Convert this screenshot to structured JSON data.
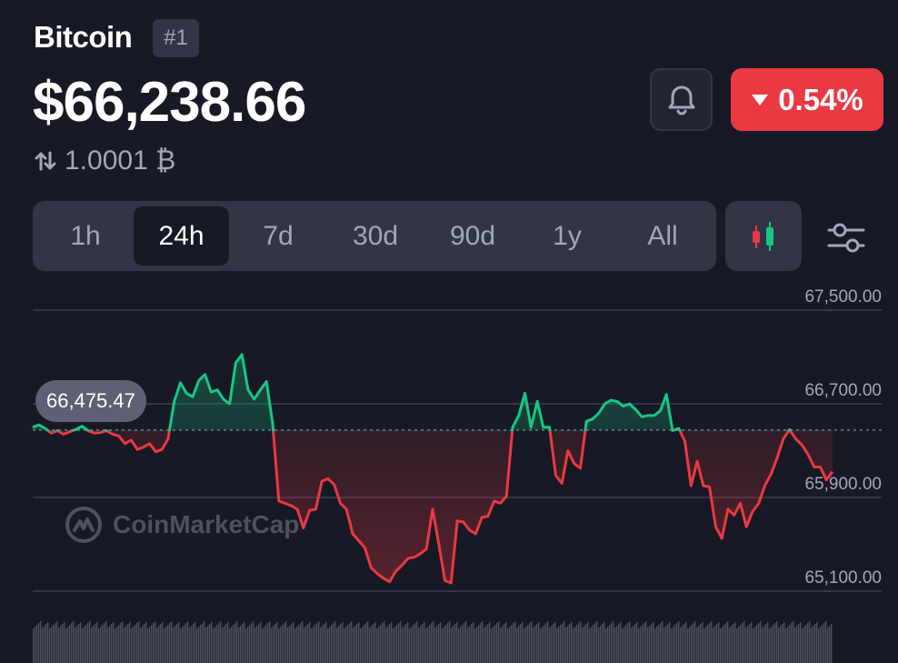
{
  "coin": {
    "name": "Bitcoin",
    "rank": "#1"
  },
  "price": "$66,238.66",
  "btc_value": "1.0001 ₿",
  "change": {
    "value": "0.54%",
    "direction": "down",
    "color": "#ea3943"
  },
  "tabs": [
    {
      "label": "1h",
      "active": false
    },
    {
      "label": "24h",
      "active": true
    },
    {
      "label": "7d",
      "active": false
    },
    {
      "label": "30d",
      "active": false
    },
    {
      "label": "90d",
      "active": false
    },
    {
      "label": "1y",
      "active": false
    },
    {
      "label": "All",
      "active": false
    }
  ],
  "tooltip": "66,475.47",
  "watermark": "CoinMarketCap",
  "colors": {
    "up": "#16c784",
    "down": "#ea3943",
    "background": "#171924",
    "panel": "#323546",
    "muted": "#a1a7bb"
  },
  "chart_data": {
    "type": "line",
    "y_ticks": [
      "67,500.00",
      "66,700.00",
      "65,900.00",
      "65,100.00"
    ],
    "ylim": [
      65100,
      67500
    ],
    "reference_value": 66475.47,
    "values": [
      66500,
      66520,
      66490,
      66450,
      66470,
      66440,
      66460,
      66480,
      66510,
      66470,
      66450,
      66455,
      66470,
      66440,
      66425,
      66360,
      66390,
      66310,
      66330,
      66360,
      66290,
      66310,
      66400,
      66720,
      66880,
      66790,
      66760,
      66900,
      66950,
      66800,
      66820,
      66740,
      66700,
      67050,
      67120,
      66820,
      66740,
      66820,
      66890,
      66530,
      65870,
      65850,
      65830,
      65800,
      65640,
      65790,
      65800,
      66040,
      66060,
      66010,
      65850,
      65800,
      65590,
      65530,
      65470,
      65300,
      65250,
      65210,
      65180,
      65270,
      65320,
      65380,
      65390,
      65420,
      65460,
      65800,
      65500,
      65190,
      65170,
      65700,
      65690,
      65620,
      65590,
      65730,
      65740,
      65870,
      65850,
      65910,
      66500,
      66600,
      66790,
      66500,
      66720,
      66500,
      66500,
      66090,
      66020,
      66300,
      66190,
      66150,
      66550,
      66570,
      66620,
      66700,
      66730,
      66720,
      66680,
      66700,
      66650,
      66590,
      66600,
      66600,
      66640,
      66780,
      66470,
      66490,
      66380,
      66000,
      66210,
      66000,
      65990,
      65650,
      65550,
      65800,
      65750,
      65850,
      65650,
      65780,
      65850,
      66000,
      66100,
      66240,
      66400,
      66480,
      66400,
      66350,
      66270,
      66160,
      66160,
      66050,
      66120
    ]
  }
}
